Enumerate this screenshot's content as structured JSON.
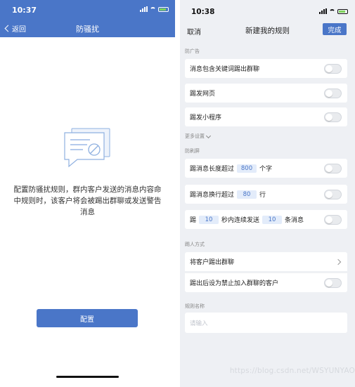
{
  "left": {
    "status": {
      "time": "10:37"
    },
    "nav": {
      "back_label": "返回",
      "title": "防骚扰"
    },
    "description": "配置防骚扰规则，群内客户发送的消息内容命中规则时，该客户将会被踢出群聊或发送警告消息",
    "config_button": "配置"
  },
  "right": {
    "status": {
      "time": "10:38"
    },
    "nav": {
      "cancel": "取消",
      "title": "新建我的规则",
      "done": "完成"
    },
    "sections": {
      "ads": "防广告",
      "more_settings": "更多设置",
      "spam": "防刷屏",
      "kick_method": "踢人方式",
      "rule_name": "规则名称"
    },
    "ad_rows": [
      "消息包含关键词踢出群聊",
      "踢发网页",
      "踢发小程序"
    ],
    "spam_rows": {
      "row1": {
        "prefix": "踢消息长度超过",
        "value": "800",
        "suffix": "个字"
      },
      "row2": {
        "prefix": "踢消息换行超过",
        "value": "80",
        "suffix": "行"
      },
      "row3": {
        "prefix": "踢",
        "value1": "10",
        "middle": "秒内连续发送",
        "value2": "10",
        "suffix": "条消息"
      }
    },
    "kick_rows": {
      "kick_out": "将客户踢出群聊",
      "ban_after_kick": "踢出后设为禁止加入群聊的客户"
    },
    "rule_name_placeholder": "请输入",
    "toggles_on": false
  },
  "watermark": "https://blog.csdn.net/WSYUNYAO",
  "colors": {
    "accent": "#4a76c8",
    "page_bg": "#eef0f4",
    "battery": "#7fd35c"
  },
  "icons": [
    "signal-icon",
    "wifi-icon",
    "battery-icon",
    "chevron-left-icon",
    "chevron-right-icon",
    "chevron-down-icon",
    "message-blocked-illustration"
  ]
}
